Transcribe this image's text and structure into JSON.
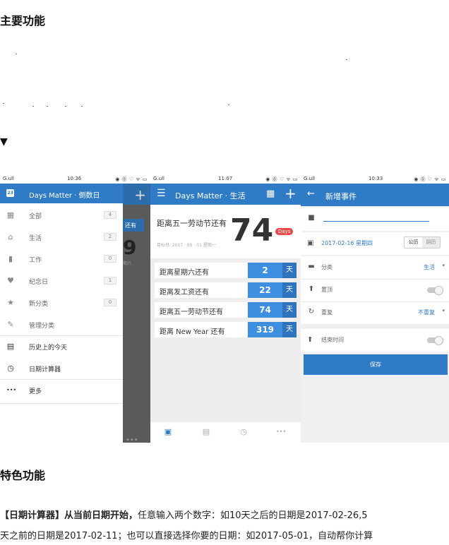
{
  "article": {
    "heading_main": "主要功能",
    "heading_feature": "特色功能",
    "toggle_glyph": "▼",
    "para_line1_bold": "【日期计算器】从当前日期开始，",
    "para_line1_rest": "任意输入两个数字：如10天之后的日期是2017-02-26,5",
    "para_line2": "天之前的日期是2017-02-11；也可以直接选择你要的日期：如2017-05-01，自动帮你计算"
  },
  "screen1": {
    "status_signal": "G.ull",
    "status_time": "10:36",
    "status_icons": "◉ ⓪ ♡ ᯤ ▭",
    "header_title": "Days Matter · 倒数日",
    "header_cal_icon": "23",
    "behind_tab": "还有",
    "behind_digit": "9",
    "behind_small": "期六",
    "behind_dots": "•••",
    "items": [
      {
        "label": "全部",
        "count": "4",
        "icon": "grid-icon",
        "glyph": "▦"
      },
      {
        "label": "生活",
        "count": "2",
        "icon": "home-icon",
        "glyph": "⌂"
      },
      {
        "label": "工作",
        "count": "0",
        "icon": "briefcase-icon",
        "glyph": "▮"
      },
      {
        "label": "纪念日",
        "count": "1",
        "icon": "heart-icon",
        "glyph": "♥"
      },
      {
        "label": "新分类",
        "count": "0",
        "icon": "star-icon",
        "glyph": "★"
      },
      {
        "label": "管理分类",
        "count": "",
        "icon": "pencil-icon",
        "glyph": "✎"
      },
      {
        "label": "历史上的今天",
        "count": "",
        "icon": "history-icon",
        "glyph": "▤"
      },
      {
        "label": "日期计算器",
        "count": "",
        "icon": "clock-icon",
        "glyph": "◷"
      },
      {
        "label": "更多",
        "count": "",
        "icon": "more-icon",
        "glyph": "•••"
      }
    ]
  },
  "screen2": {
    "status_signal": "G.ull",
    "status_time": "11:07",
    "status_icons": "◉ ⓪ ♡ ᯤ ▭",
    "header_title": "Days Matter · 生活",
    "menu_glyph": "☰",
    "grid_glyph": "▦",
    "plus_glyph": "+",
    "hero_title": "距离五一劳动节还有",
    "hero_sub": "目标日: 2017 · 05 · 01 星期一",
    "hero_number": "74",
    "hero_badge": "Days",
    "events": [
      {
        "label": "距离星期六还有",
        "value": "2",
        "unit": "天"
      },
      {
        "label": "距离发工资还有",
        "value": "22",
        "unit": "天"
      },
      {
        "label": "距离五一劳动节还有",
        "value": "74",
        "unit": "天"
      },
      {
        "label": "距离 New Year 还有",
        "value": "319",
        "unit": "天"
      }
    ],
    "tabs": [
      "▣",
      "▤",
      "◷",
      "•••"
    ]
  },
  "screen3": {
    "status_signal": "G.ull",
    "status_time": "10:33",
    "status_icons": "◉ ⓪ ♡ ᯤ ▭",
    "header_title": "新增事件",
    "back_glyph": "←",
    "date_value": "2017-02-16 星期四",
    "calendar_solar": "公历",
    "calendar_lunar": "阴历",
    "category_label": "分类",
    "category_value": "生活",
    "pin_label": "置顶",
    "repeat_label": "重复",
    "repeat_value": "不重复",
    "end_time_label": "结束时间",
    "save_label": "保存",
    "dropdown_glyph": "▾"
  },
  "colors": {
    "accent": "#2f7bc6",
    "value_cell": "#3f8fe0",
    "badge": "#e94848"
  }
}
